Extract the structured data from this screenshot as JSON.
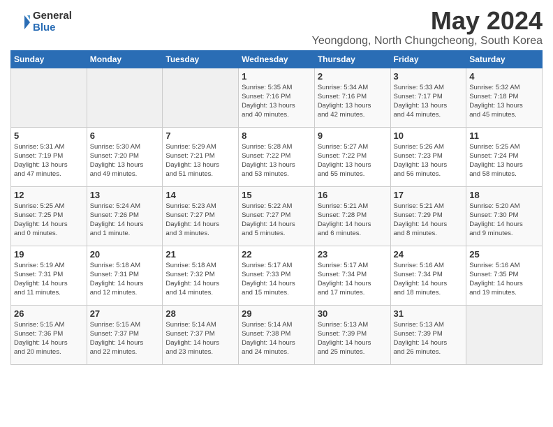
{
  "header": {
    "logo_general": "General",
    "logo_blue": "Blue",
    "month_title": "May 2024",
    "location": "Yeongdong, North Chungcheong, South Korea"
  },
  "weekdays": [
    "Sunday",
    "Monday",
    "Tuesday",
    "Wednesday",
    "Thursday",
    "Friday",
    "Saturday"
  ],
  "weeks": [
    [
      {
        "day": "",
        "info": ""
      },
      {
        "day": "",
        "info": ""
      },
      {
        "day": "",
        "info": ""
      },
      {
        "day": "1",
        "info": "Sunrise: 5:35 AM\nSunset: 7:16 PM\nDaylight: 13 hours\nand 40 minutes."
      },
      {
        "day": "2",
        "info": "Sunrise: 5:34 AM\nSunset: 7:16 PM\nDaylight: 13 hours\nand 42 minutes."
      },
      {
        "day": "3",
        "info": "Sunrise: 5:33 AM\nSunset: 7:17 PM\nDaylight: 13 hours\nand 44 minutes."
      },
      {
        "day": "4",
        "info": "Sunrise: 5:32 AM\nSunset: 7:18 PM\nDaylight: 13 hours\nand 45 minutes."
      }
    ],
    [
      {
        "day": "5",
        "info": "Sunrise: 5:31 AM\nSunset: 7:19 PM\nDaylight: 13 hours\nand 47 minutes."
      },
      {
        "day": "6",
        "info": "Sunrise: 5:30 AM\nSunset: 7:20 PM\nDaylight: 13 hours\nand 49 minutes."
      },
      {
        "day": "7",
        "info": "Sunrise: 5:29 AM\nSunset: 7:21 PM\nDaylight: 13 hours\nand 51 minutes."
      },
      {
        "day": "8",
        "info": "Sunrise: 5:28 AM\nSunset: 7:22 PM\nDaylight: 13 hours\nand 53 minutes."
      },
      {
        "day": "9",
        "info": "Sunrise: 5:27 AM\nSunset: 7:22 PM\nDaylight: 13 hours\nand 55 minutes."
      },
      {
        "day": "10",
        "info": "Sunrise: 5:26 AM\nSunset: 7:23 PM\nDaylight: 13 hours\nand 56 minutes."
      },
      {
        "day": "11",
        "info": "Sunrise: 5:25 AM\nSunset: 7:24 PM\nDaylight: 13 hours\nand 58 minutes."
      }
    ],
    [
      {
        "day": "12",
        "info": "Sunrise: 5:25 AM\nSunset: 7:25 PM\nDaylight: 14 hours\nand 0 minutes."
      },
      {
        "day": "13",
        "info": "Sunrise: 5:24 AM\nSunset: 7:26 PM\nDaylight: 14 hours\nand 1 minute."
      },
      {
        "day": "14",
        "info": "Sunrise: 5:23 AM\nSunset: 7:27 PM\nDaylight: 14 hours\nand 3 minutes."
      },
      {
        "day": "15",
        "info": "Sunrise: 5:22 AM\nSunset: 7:27 PM\nDaylight: 14 hours\nand 5 minutes."
      },
      {
        "day": "16",
        "info": "Sunrise: 5:21 AM\nSunset: 7:28 PM\nDaylight: 14 hours\nand 6 minutes."
      },
      {
        "day": "17",
        "info": "Sunrise: 5:21 AM\nSunset: 7:29 PM\nDaylight: 14 hours\nand 8 minutes."
      },
      {
        "day": "18",
        "info": "Sunrise: 5:20 AM\nSunset: 7:30 PM\nDaylight: 14 hours\nand 9 minutes."
      }
    ],
    [
      {
        "day": "19",
        "info": "Sunrise: 5:19 AM\nSunset: 7:31 PM\nDaylight: 14 hours\nand 11 minutes."
      },
      {
        "day": "20",
        "info": "Sunrise: 5:18 AM\nSunset: 7:31 PM\nDaylight: 14 hours\nand 12 minutes."
      },
      {
        "day": "21",
        "info": "Sunrise: 5:18 AM\nSunset: 7:32 PM\nDaylight: 14 hours\nand 14 minutes."
      },
      {
        "day": "22",
        "info": "Sunrise: 5:17 AM\nSunset: 7:33 PM\nDaylight: 14 hours\nand 15 minutes."
      },
      {
        "day": "23",
        "info": "Sunrise: 5:17 AM\nSunset: 7:34 PM\nDaylight: 14 hours\nand 17 minutes."
      },
      {
        "day": "24",
        "info": "Sunrise: 5:16 AM\nSunset: 7:34 PM\nDaylight: 14 hours\nand 18 minutes."
      },
      {
        "day": "25",
        "info": "Sunrise: 5:16 AM\nSunset: 7:35 PM\nDaylight: 14 hours\nand 19 minutes."
      }
    ],
    [
      {
        "day": "26",
        "info": "Sunrise: 5:15 AM\nSunset: 7:36 PM\nDaylight: 14 hours\nand 20 minutes."
      },
      {
        "day": "27",
        "info": "Sunrise: 5:15 AM\nSunset: 7:37 PM\nDaylight: 14 hours\nand 22 minutes."
      },
      {
        "day": "28",
        "info": "Sunrise: 5:14 AM\nSunset: 7:37 PM\nDaylight: 14 hours\nand 23 minutes."
      },
      {
        "day": "29",
        "info": "Sunrise: 5:14 AM\nSunset: 7:38 PM\nDaylight: 14 hours\nand 24 minutes."
      },
      {
        "day": "30",
        "info": "Sunrise: 5:13 AM\nSunset: 7:39 PM\nDaylight: 14 hours\nand 25 minutes."
      },
      {
        "day": "31",
        "info": "Sunrise: 5:13 AM\nSunset: 7:39 PM\nDaylight: 14 hours\nand 26 minutes."
      },
      {
        "day": "",
        "info": ""
      }
    ]
  ]
}
